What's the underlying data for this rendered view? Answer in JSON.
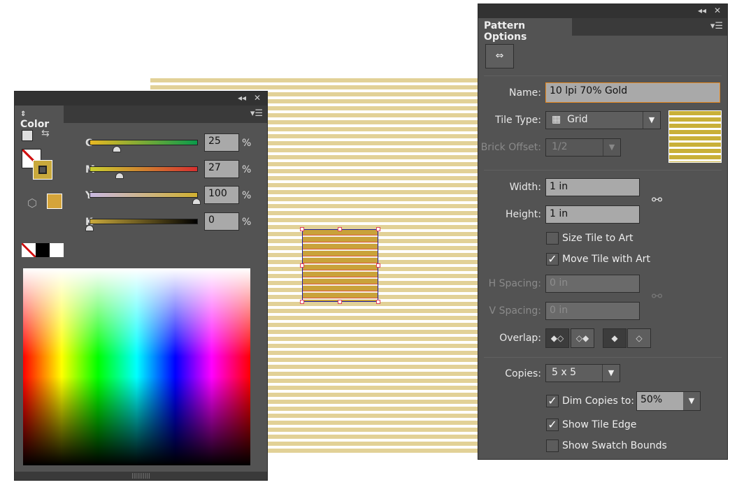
{
  "color_panel": {
    "title": "Color",
    "channels": [
      {
        "label": "C",
        "value": "25",
        "unit": "%",
        "fraction": 0.25
      },
      {
        "label": "M",
        "value": "27",
        "unit": "%",
        "fraction": 0.27
      },
      {
        "label": "Y",
        "value": "100",
        "unit": "%",
        "fraction": 1.0
      },
      {
        "label": "K",
        "value": "0",
        "unit": "%",
        "fraction": 0
      }
    ],
    "fill_color": "#c9a93c",
    "swatch_color": "#d4a43a"
  },
  "pattern_panel": {
    "title": "Pattern Options",
    "name_label": "Name:",
    "name_value": "10 lpi 70% Gold",
    "tile_type_label": "Tile Type:",
    "tile_type_value": "Grid",
    "brick_offset_label": "Brick Offset:",
    "brick_offset_value": "1/2",
    "width_label": "Width:",
    "width_value": "1 in",
    "height_label": "Height:",
    "height_value": "1 in",
    "size_tile_label": "Size Tile to Art",
    "size_tile_checked": false,
    "move_tile_label": "Move Tile with Art",
    "move_tile_checked": true,
    "h_spacing_label": "H Spacing:",
    "h_spacing_value": "0 in",
    "v_spacing_label": "V Spacing:",
    "v_spacing_value": "0 in",
    "overlap_label": "Overlap:",
    "copies_label": "Copies:",
    "copies_value": "5 x 5",
    "dim_copies_label": "Dim Copies to:",
    "dim_copies_checked": true,
    "dim_copies_value": "50%",
    "show_tile_edge_label": "Show Tile Edge",
    "show_tile_edge_checked": true,
    "show_swatch_bounds_label": "Show Swatch Bounds",
    "show_swatch_bounds_checked": false
  },
  "colors": {
    "pattern_gold": "#e2d197",
    "tile_gold": "#c9a23a",
    "panel_bg": "#535353"
  }
}
